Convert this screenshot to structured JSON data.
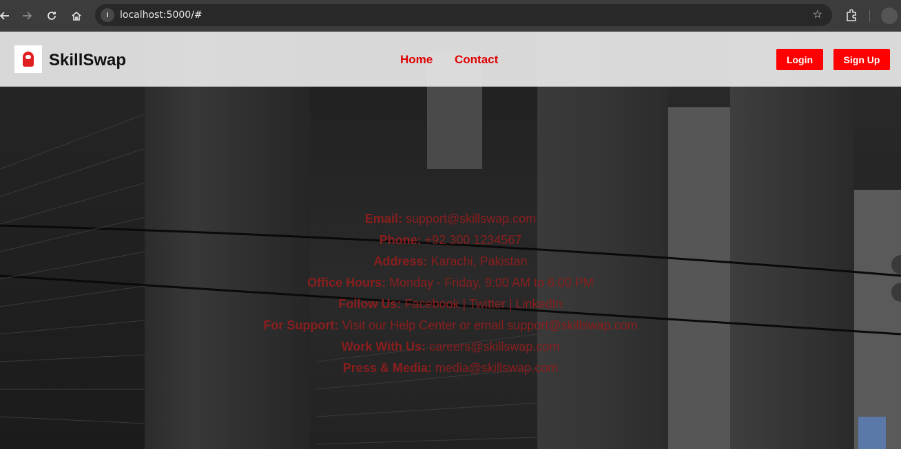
{
  "browser": {
    "url": "localhost:5000/#",
    "icons": [
      "back-icon",
      "forward-icon",
      "reload-icon",
      "home-icon",
      "site-info-icon",
      "star-icon",
      "extensions-icon",
      "profile-icon"
    ]
  },
  "header": {
    "brand": "SkillSwap",
    "logo_text": "Skill",
    "nav": [
      {
        "label": "Home"
      },
      {
        "label": "Contact"
      }
    ],
    "login_label": "Login",
    "signup_label": "Sign Up"
  },
  "contact": {
    "rows": [
      {
        "label": "Email:",
        "value": "support@skillswap.com"
      },
      {
        "label": "Phone:",
        "value": "+92 300 1234567"
      },
      {
        "label": "Address:",
        "value": "Karachi, Pakistan"
      },
      {
        "label": "Office Hours:",
        "value": "Monday - Friday, 9:00 AM to 6:00 PM"
      },
      {
        "label": "Follow Us:",
        "value": "Facebook | Twitter | LinkedIn"
      },
      {
        "label": "For Support:",
        "value": "Visit our Help Center or email support@skillswap.com"
      },
      {
        "label": "Work With Us:",
        "value": "careers@skillswap.com"
      },
      {
        "label": "Press & Media:",
        "value": "media@skillswap.com"
      }
    ]
  },
  "colors": {
    "accent": "#ff0000",
    "nav_link": "#e00000",
    "contact_text": "#8a1e1e"
  }
}
